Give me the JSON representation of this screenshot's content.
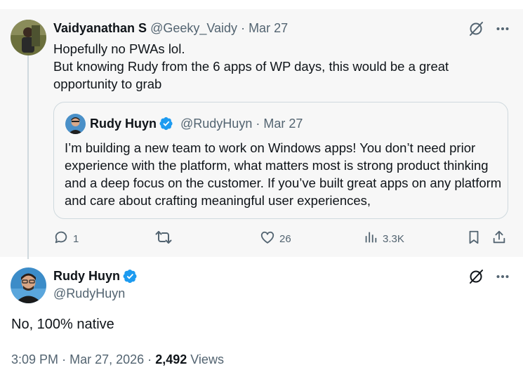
{
  "parent_tweet": {
    "author_name": "Vaidyanathan S",
    "handle": "@Geeky_Vaidy",
    "separator": "·",
    "date": "Mar 27",
    "text_line1": "Hopefully no PWAs lol.",
    "text_line2": "But knowing Rudy from the 6 apps of WP days, this would be a great opportunity to grab",
    "quoted": {
      "author_name": "Rudy Huyn",
      "handle": "@RudyHuyn",
      "separator": "·",
      "date": "Mar 27",
      "text": "I’m building a new team to work on Windows apps! You don’t need prior experience with the platform, what matters most is strong product thinking and a deep focus on the customer.  If you’ve built great apps on any platform and care about crafting meaningful user experiences,"
    },
    "actions": {
      "replies": "1",
      "likes": "26",
      "views": "3.3K"
    }
  },
  "main_tweet": {
    "author_name": "Rudy Huyn",
    "handle": "@RudyHuyn",
    "text": "No, 100% native",
    "time": "3:09 PM",
    "separator": "·",
    "date": "Mar 27, 2026",
    "views_count": "2,492",
    "views_label": "Views"
  },
  "icons": {
    "grok": "grok-icon",
    "more": "more-icon",
    "reply": "reply-icon",
    "retweet": "retweet-icon",
    "like": "like-icon",
    "views": "views-icon",
    "bookmark": "bookmark-icon",
    "share": "share-icon",
    "verified": "verified-badge-icon"
  },
  "colors": {
    "text": "#0f1419",
    "secondary": "#536471",
    "verified": "#1d9bf0",
    "context_background": "#f7f7f7",
    "border": "#cfd9de"
  }
}
